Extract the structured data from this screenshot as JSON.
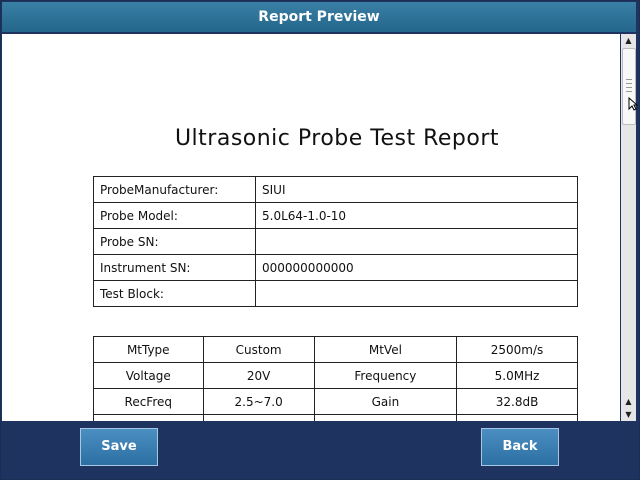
{
  "window": {
    "title": "Report Preview"
  },
  "report": {
    "title": "Ultrasonic Probe Test Report",
    "info_rows": [
      {
        "label": "ProbeManufacturer:",
        "value": "SIUI"
      },
      {
        "label": "Probe Model:",
        "value": "5.0L64-1.0-10"
      },
      {
        "label": "Probe SN:",
        "value": ""
      },
      {
        "label": "Instrument SN:",
        "value": "000000000000"
      },
      {
        "label": "Test Block:",
        "value": ""
      }
    ],
    "param_rows": [
      [
        "MtType",
        "Custom",
        "MtVel",
        "2500m/s"
      ],
      [
        "Voltage",
        "20V",
        "Frequency",
        "5.0MHz"
      ],
      [
        "RecFreq",
        "2.5~7.0",
        "Gain",
        "32.8dB"
      ]
    ]
  },
  "buttons": {
    "save": "Save",
    "back": "Back"
  }
}
